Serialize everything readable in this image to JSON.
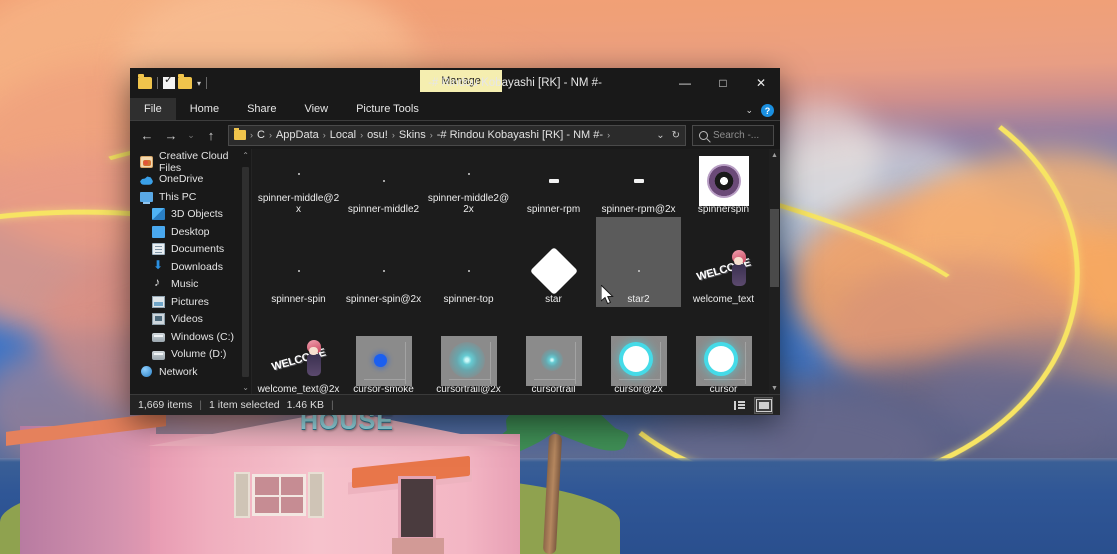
{
  "window": {
    "title": "-# Rindou Kobayashi [RK] - NM #-",
    "manage_tab": "Manage",
    "minimize": "—",
    "maximize": "□",
    "close": "✕",
    "ribbon_chevron": "⌄",
    "help": "?"
  },
  "ribbon": {
    "tabs": [
      {
        "label": "File"
      },
      {
        "label": "Home"
      },
      {
        "label": "Share"
      },
      {
        "label": "View"
      },
      {
        "label": "Picture Tools"
      }
    ]
  },
  "nav": {
    "back": "←",
    "forward": "→",
    "recent": "⌄",
    "up": "↑",
    "breadcrumbs": [
      "C",
      "AppData",
      "Local",
      "osu!",
      "Skins",
      "-# Rindou Kobayashi [RK] - NM #-"
    ],
    "separator": "›",
    "history_caret": "⌄",
    "refresh": "↻"
  },
  "search": {
    "placeholder": "Search -..."
  },
  "sidebar": {
    "items": [
      {
        "label": "Creative Cloud Files",
        "icon": "creative-cloud-icon",
        "indent": false
      },
      {
        "label": "OneDrive",
        "icon": "onedrive-cloud-icon",
        "indent": false
      },
      {
        "label": "This PC",
        "icon": "this-pc-icon",
        "indent": false
      },
      {
        "label": "3D Objects",
        "icon": "3d-objects-icon",
        "indent": true
      },
      {
        "label": "Desktop",
        "icon": "desktop-icon",
        "indent": true
      },
      {
        "label": "Documents",
        "icon": "documents-icon",
        "indent": true
      },
      {
        "label": "Downloads",
        "icon": "downloads-icon",
        "indent": true
      },
      {
        "label": "Music",
        "icon": "music-note-icon",
        "indent": true
      },
      {
        "label": "Pictures",
        "icon": "pictures-icon",
        "indent": true
      },
      {
        "label": "Videos",
        "icon": "videos-icon",
        "indent": true
      },
      {
        "label": "Windows (C:)",
        "icon": "drive-icon",
        "indent": true
      },
      {
        "label": "Volume (D:)",
        "icon": "drive-icon",
        "indent": true
      },
      {
        "label": "Network",
        "icon": "network-icon",
        "indent": false
      }
    ],
    "scroll_up": "⌃",
    "scroll_down": "⌄"
  },
  "files": {
    "row1": [
      {
        "name": "spinner-middle@2x",
        "thumb": "tiny-dot"
      },
      {
        "name": "spinner-middle2",
        "thumb": "tiny-dot"
      },
      {
        "name": "spinner-middle2@2x",
        "thumb": "tiny-dot"
      },
      {
        "name": "spinner-rpm",
        "thumb": "white-bar"
      },
      {
        "name": "spinner-rpm@2x",
        "thumb": "white-bar"
      },
      {
        "name": "spinnerspin",
        "thumb": "spinner-ring"
      }
    ],
    "row2": [
      {
        "name": "spinner-spin",
        "thumb": "tiny-dot"
      },
      {
        "name": "spinner-spin@2x",
        "thumb": "tiny-dot"
      },
      {
        "name": "spinner-top",
        "thumb": "tiny-dot"
      },
      {
        "name": "star",
        "thumb": "white-diamond"
      },
      {
        "name": "star2",
        "thumb": "gray-block",
        "selected": true
      },
      {
        "name": "welcome_text",
        "thumb": "welcome-art"
      }
    ],
    "row3": [
      {
        "name": "welcome_text@2x",
        "thumb": "welcome-art"
      },
      {
        "name": "cursor-smoke",
        "thumb": "blue-dot"
      },
      {
        "name": "cursortrail@2x",
        "thumb": "cyan-glow-large"
      },
      {
        "name": "cursortrail",
        "thumb": "cyan-glow-small"
      },
      {
        "name": "cursor@2x",
        "thumb": "cyan-cursor-ring"
      },
      {
        "name": "cursor",
        "thumb": "cyan-cursor-ring"
      }
    ],
    "welcome_word": "WELCOME"
  },
  "status": {
    "item_count": "1,669 items",
    "separator": "|",
    "selection": "1 item selected",
    "size": "1.46 KB",
    "trailing_separator": "|"
  },
  "wallpaper": {
    "house_sign": "HOUSE"
  },
  "colors": {
    "window_bg": "#191919",
    "content_bg": "#1c1c1c",
    "manage_tab": "#f5eeb0",
    "selection": "#5b5b5b",
    "accent_cyan": "#45dbe8",
    "ribbon_yellow": "#f7e463",
    "help_blue": "#1a8fe0"
  }
}
